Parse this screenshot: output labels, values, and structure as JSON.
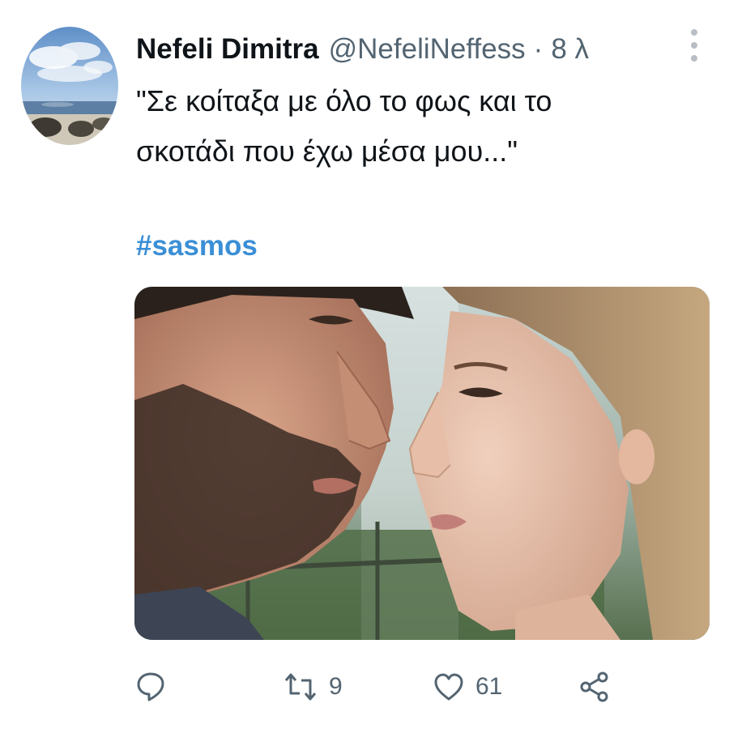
{
  "tweet": {
    "display_name": "Nefeli Dimitra",
    "handle": "@NefeliNeffess",
    "separator": "·",
    "time": "8 λ",
    "text_line1": "\"Σε κοίταξα με όλο το φως και το",
    "text_line2": "σκοτάδι που έχω μέσα μου...\"",
    "hashtag": "#sasmos",
    "media_description_icon": "photo-of-couple-close-up",
    "hashtag_color": "#3b8fd6"
  },
  "actions": {
    "reply_icon": "reply-icon",
    "retweet_icon": "retweet-icon",
    "retweet_count": "9",
    "like_icon": "heart-icon",
    "like_count": "61",
    "share_icon": "share-icon"
  },
  "colors": {
    "text_primary": "#0f1419",
    "text_secondary": "#536471",
    "accent": "#3b8fd6"
  }
}
